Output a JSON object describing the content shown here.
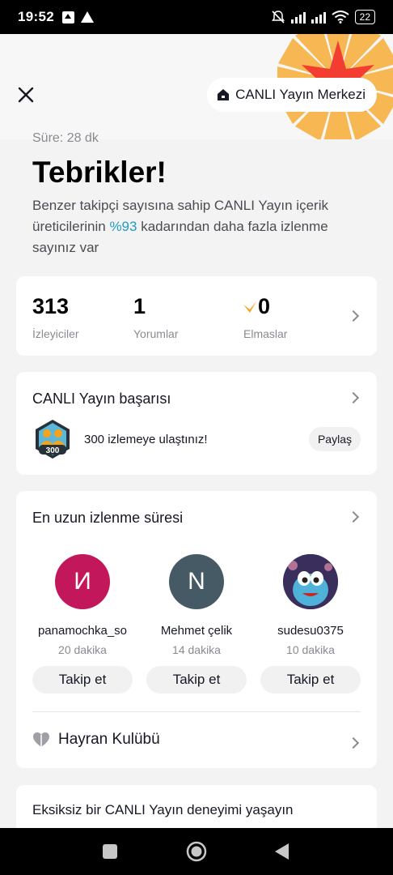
{
  "status_bar": {
    "time": "19:52",
    "battery": "22"
  },
  "header": {
    "center_label": "CANLI Yayın Merkezi"
  },
  "summary": {
    "duration": "Süre: 28 dk",
    "title": "Tebrikler!",
    "desc_part1": "Benzer takipçi sayısına sahip CANLI Yayın içerik üreticilerinin ",
    "desc_highlight": "%93",
    "desc_part2": " kadarından daha fazla izlenme sayınız var"
  },
  "stats": [
    {
      "value": "313",
      "label": "İzleyiciler"
    },
    {
      "value": "1",
      "label": "Yorumlar"
    },
    {
      "value": "0",
      "label": "Elmaslar"
    }
  ],
  "achievement": {
    "title": "CANLI Yayın başarısı",
    "badge_number": "300",
    "text": "300 izlemeye ulaştınız!",
    "share_label": "Paylaş"
  },
  "longest_watch": {
    "title": "En uzun izlenme süresi",
    "viewers": [
      {
        "initial": "И",
        "name": "panamochka_so",
        "time": "20 dakika",
        "follow": "Takip et",
        "color": "#c2185b"
      },
      {
        "initial": "N",
        "name": "Mehmet çelik",
        "time": "14 dakika",
        "follow": "Takip et",
        "color": "#455a64"
      },
      {
        "initial": "",
        "name": "sudesu0375",
        "time": "10 dakika",
        "follow": "Takip et",
        "color": "#3a2f5c"
      }
    ],
    "fan_club": "Hayran Kulübü"
  },
  "experience": {
    "title": "Eksiksiz bir CANLI Yayın deneyimi yaşayın"
  },
  "colors": {
    "accent": "#1f9cc4",
    "burst_orange": "#f7a21b",
    "burst_red": "#f23d30"
  }
}
